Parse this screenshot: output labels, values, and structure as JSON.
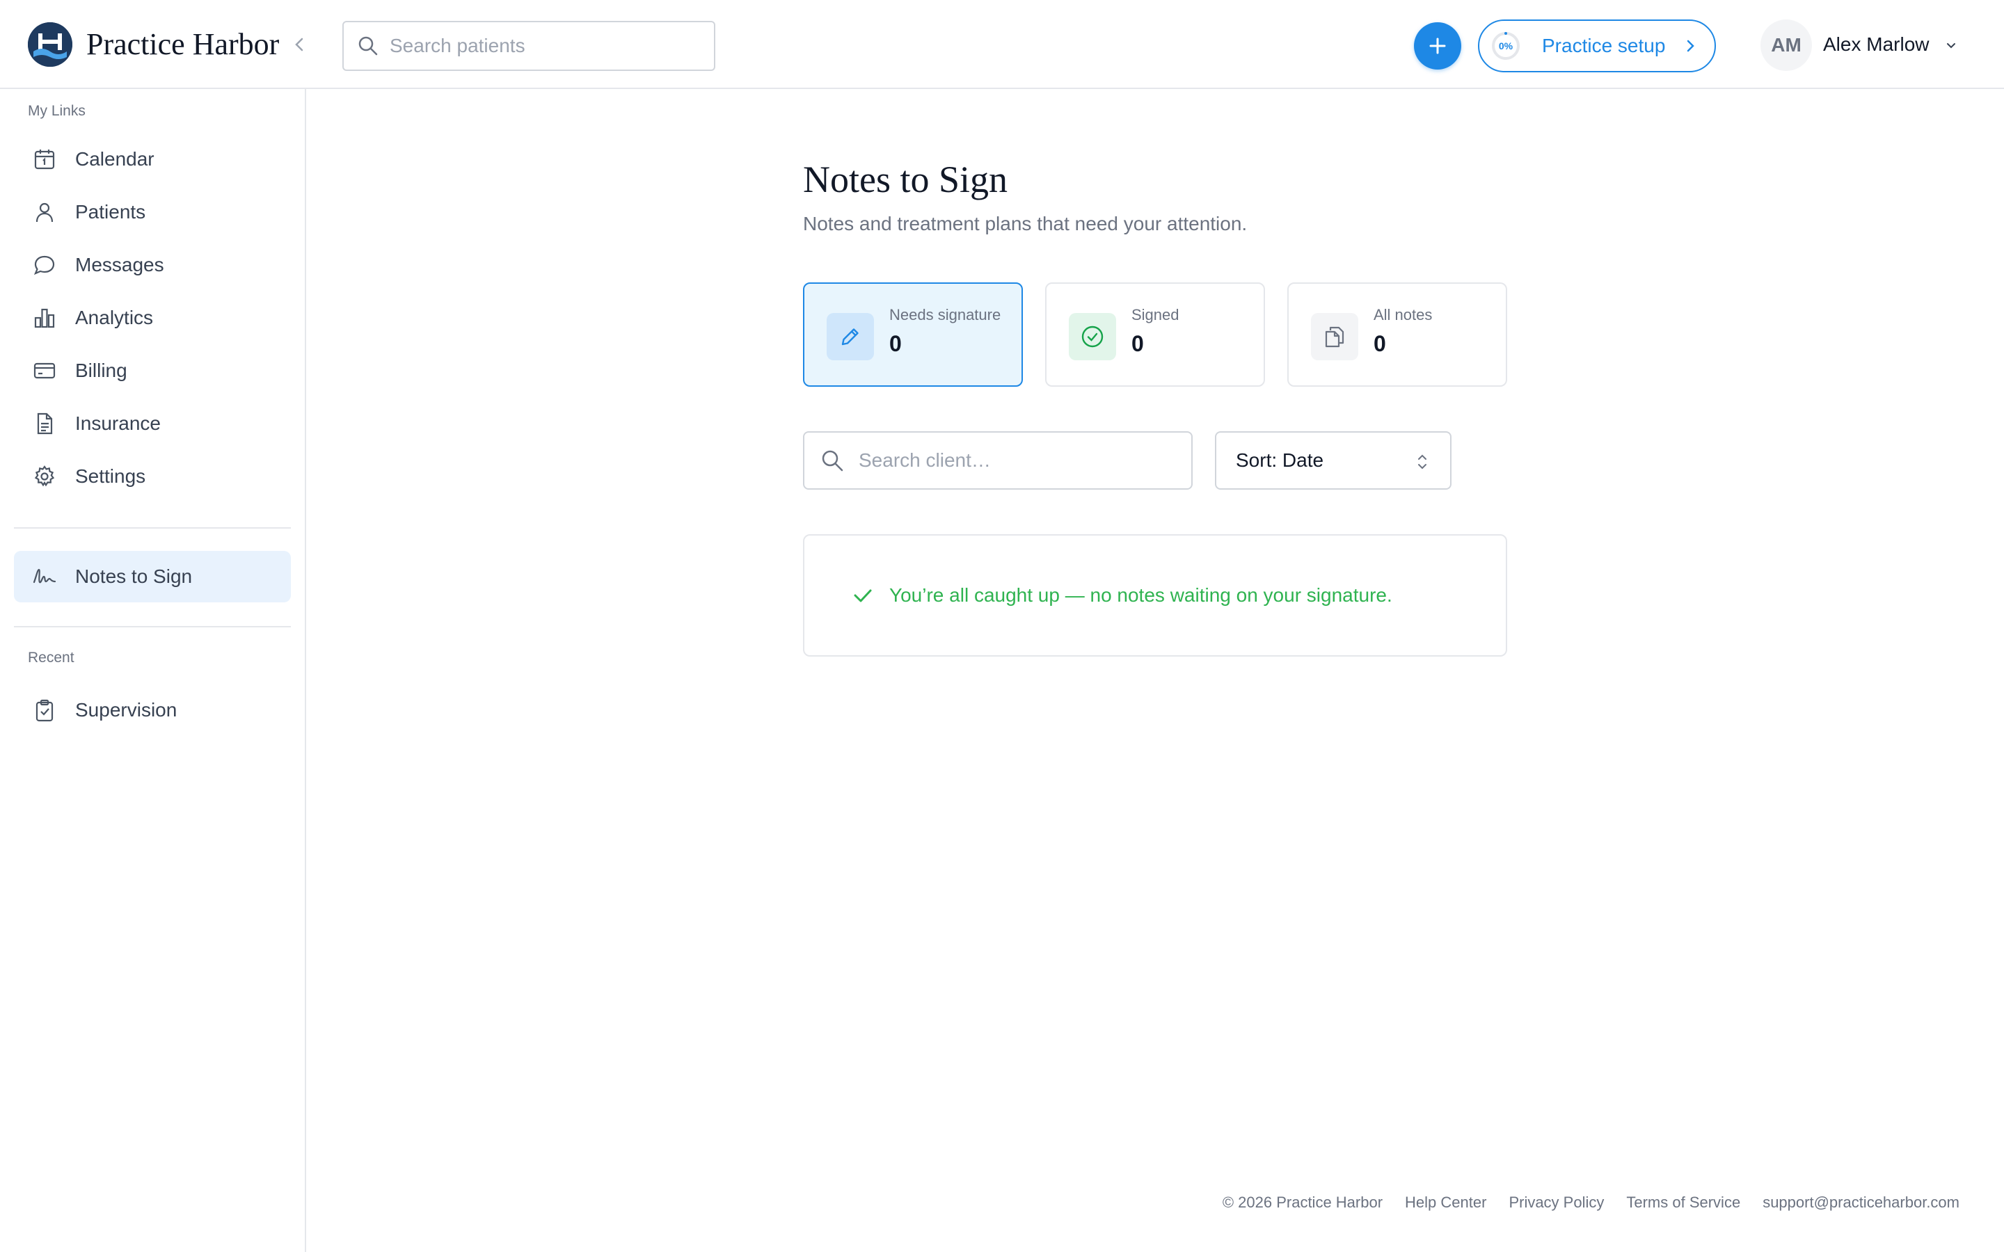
{
  "app": {
    "brand": "Practice Harbor",
    "search_placeholder": "Search patients",
    "setup": {
      "progress_label": "0%",
      "progress": 0,
      "label": "Practice setup"
    },
    "user": {
      "initials": "AM",
      "name": "Alex Marlow"
    },
    "accent": "#1e88e5"
  },
  "sidebar": {
    "my_links_label": "My Links",
    "items": [
      {
        "label": "Calendar",
        "icon": "calendar-icon"
      },
      {
        "label": "Patients",
        "icon": "person-icon"
      },
      {
        "label": "Messages",
        "icon": "chat-bubble-icon"
      },
      {
        "label": "Analytics",
        "icon": "bar-chart-icon"
      },
      {
        "label": "Billing",
        "icon": "credit-card-icon"
      },
      {
        "label": "Insurance",
        "icon": "document-icon"
      },
      {
        "label": "Settings",
        "icon": "gear-icon"
      }
    ],
    "pinned": {
      "label": "Notes to Sign",
      "icon": "signature-icon"
    },
    "recent_label": "Recent",
    "recent_items": [
      {
        "label": "Supervision",
        "icon": "clipboard-check-icon"
      }
    ]
  },
  "main": {
    "title": "Notes to Sign",
    "subtitle": "Notes and treatment plans that need your attention.",
    "stats": [
      {
        "label": "Needs signature",
        "value": "0",
        "icon": "pencil-icon"
      },
      {
        "label": "Signed",
        "value": "0",
        "icon": "check-circle-icon"
      },
      {
        "label": "All notes",
        "value": "0",
        "icon": "copy-documents-icon"
      }
    ],
    "search_placeholder": "Search client…",
    "sort_label": "Sort: Date",
    "empty_message": "You’re all caught up — no notes waiting on your signature.",
    "success_color": "#2fb350"
  },
  "footer": {
    "copyright": "© 2026 Practice Harbor",
    "links": [
      "Help Center",
      "Privacy Policy",
      "Terms of Service",
      "support@practiceharbor.com"
    ]
  }
}
